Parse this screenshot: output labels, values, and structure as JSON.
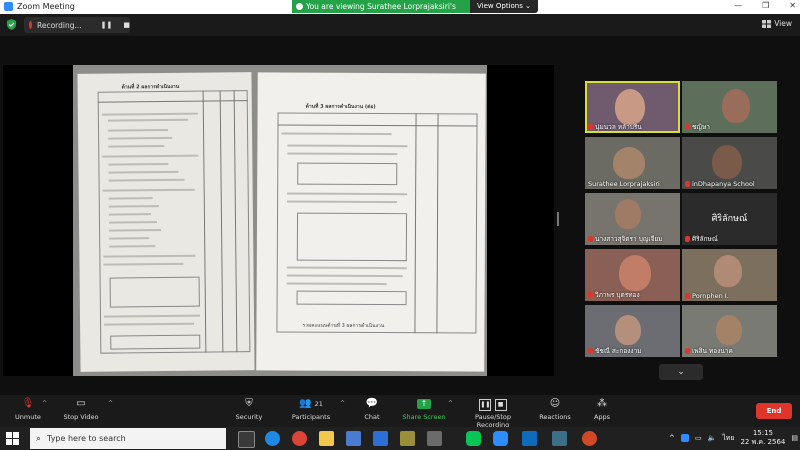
{
  "window": {
    "title": "Zoom Meeting",
    "minimize": "—",
    "restore": "❐",
    "close": "✕"
  },
  "share_banner": {
    "text": "You are viewing Surathee  Lorprajaksiri's screen",
    "view_options": "View Options ⌄"
  },
  "recording": {
    "label": "Recording...",
    "pause": "❚❚",
    "stop": "■"
  },
  "view_button": {
    "label": "View"
  },
  "document": {
    "left_heading": "ด้านที่ 2  ผลการดำเนินงาน",
    "right_heading": "ด้านที่ 3  ผลการดำเนินงาน (ต่อ)",
    "right_footer": "รวมคะแนนด้านที่ 3  ผลการดำเนินงาน"
  },
  "participants": [
    {
      "name": "นุ่มนวล หล้าบริน",
      "muted": true
    },
    {
      "name": "ชญิษา",
      "muted": true
    },
    {
      "name": "Surathee  Lorprajaksiri",
      "muted": false
    },
    {
      "name": "inDhapanya School",
      "muted": true
    },
    {
      "name": "นางสาวสุจิตรา บุญเจียม",
      "muted": true
    },
    {
      "name": "ศิริลักษณ์",
      "muted": true,
      "display": "ศิริลักษณ์"
    },
    {
      "name": "วิภาพร บุตรทอง",
      "muted": true
    },
    {
      "name": "Pornphen I.",
      "muted": true
    },
    {
      "name": "ชัชณี สะกองงาม",
      "muted": true
    },
    {
      "name": "เพลิน ทองนาค",
      "muted": true
    }
  ],
  "toolbar": {
    "unmute": "Unmute",
    "stop_video": "Stop Video",
    "security": "Security",
    "participants": "Participants",
    "participants_count": "21",
    "chat": "Chat",
    "share_screen": "Share Screen",
    "pause_recording": "Pause/Stop Recording",
    "reactions": "Reactions",
    "apps": "Apps",
    "end": "End"
  },
  "taskbar": {
    "search_placeholder": "Type here to search",
    "language": "ไทย",
    "time": "15:15",
    "date": "22 พ.ค. 2564"
  },
  "colors": {
    "share_green": "#23a248",
    "end_red": "#e0352b",
    "active_speaker": "#d8e12a",
    "zoom_blue": "#2d8cff"
  }
}
